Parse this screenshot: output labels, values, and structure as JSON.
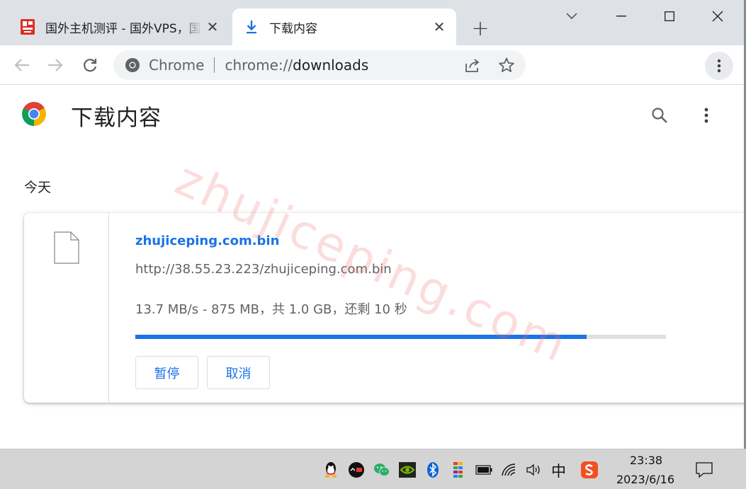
{
  "tabs": [
    {
      "title": "国外主机测评 - 国外VPS，国",
      "close": "✕",
      "favicon": "site-logo-icon"
    },
    {
      "title": "下载内容",
      "close": "✕",
      "favicon": "download-icon"
    }
  ],
  "new_tab": "+",
  "omnibox": {
    "chip": "Chrome",
    "url_scheme": "chrome://",
    "url_host": "downloads"
  },
  "page": {
    "title": "下载内容",
    "section": "今天"
  },
  "download": {
    "file_name": "zhujiceping.com.bin",
    "url": "http://38.55.23.223/zhujiceping.com.bin",
    "status": "13.7 MB/s - 875 MB，共 1.0 GB，还剩 10 秒",
    "progress": 0.85,
    "pause_label": "暂停",
    "cancel_label": "取消"
  },
  "watermark": "zhujiceping.com",
  "taskbar": {
    "ime": "中",
    "time": "23:38",
    "date": "2023/6/16"
  },
  "colors": {
    "accent": "#1a73e8",
    "tabstrip": "#dee1e6",
    "taskbar": "#d4d4d4"
  }
}
